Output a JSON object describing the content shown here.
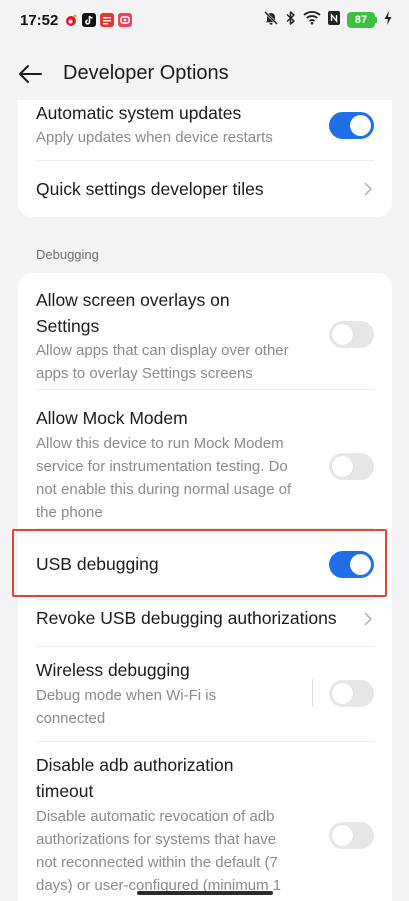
{
  "status_bar": {
    "time": "17:52",
    "battery_level": "87",
    "icons": [
      "weibo-app-icon",
      "tiktok-app-icon",
      "news-app-icon",
      "red-app-icon",
      "silent-bell-icon",
      "bluetooth-icon",
      "wifi-icon",
      "nfc-icon",
      "charging-icon"
    ],
    "battery_color": "#3fbf3f"
  },
  "header": {
    "title": "Developer Options"
  },
  "top_card": {
    "items": [
      {
        "title": "Automatic system updates",
        "subtitle": "Apply updates when device restarts",
        "control": "toggle",
        "enabled": true
      },
      {
        "title": "Quick settings developer tiles",
        "control": "chevron"
      }
    ]
  },
  "debugging": {
    "section_label": "Debugging",
    "items": [
      {
        "title_line1": "Allow screen overlays on",
        "title_line2": "Settings",
        "sub_line1": "Allow apps that can display over other",
        "sub_line2": "apps to overlay Settings screens",
        "control": "toggle",
        "enabled": false
      },
      {
        "title": "Allow Mock Modem",
        "sub_line1": "Allow this device to run Mock Modem",
        "sub_line2": "service for instrumentation testing. Do",
        "sub_line3": "not enable this during normal usage of",
        "sub_line4": "the phone",
        "control": "toggle",
        "enabled": false
      },
      {
        "title": "USB debugging",
        "control": "toggle",
        "enabled": true,
        "highlighted": true
      },
      {
        "title": "Revoke USB debugging authorizations",
        "control": "chevron"
      },
      {
        "title": "Wireless debugging",
        "sub_line1": "Debug mode when Wi-Fi is",
        "sub_line2": "connected",
        "control": "toggle",
        "enabled": false
      },
      {
        "title_line1": "Disable adb authorization",
        "title_line2": "timeout",
        "sub_line1": "Disable automatic revocation of adb",
        "sub_line2": "authorizations for systems that have",
        "sub_line3": "not reconnected within the default (7",
        "sub_line4": "days) or user-configured (minimum 1",
        "control": "toggle",
        "enabled": false
      }
    ]
  },
  "colors": {
    "accent": "#1f6fe8",
    "highlight": "#e8432e",
    "background": "#f3f3f5"
  }
}
